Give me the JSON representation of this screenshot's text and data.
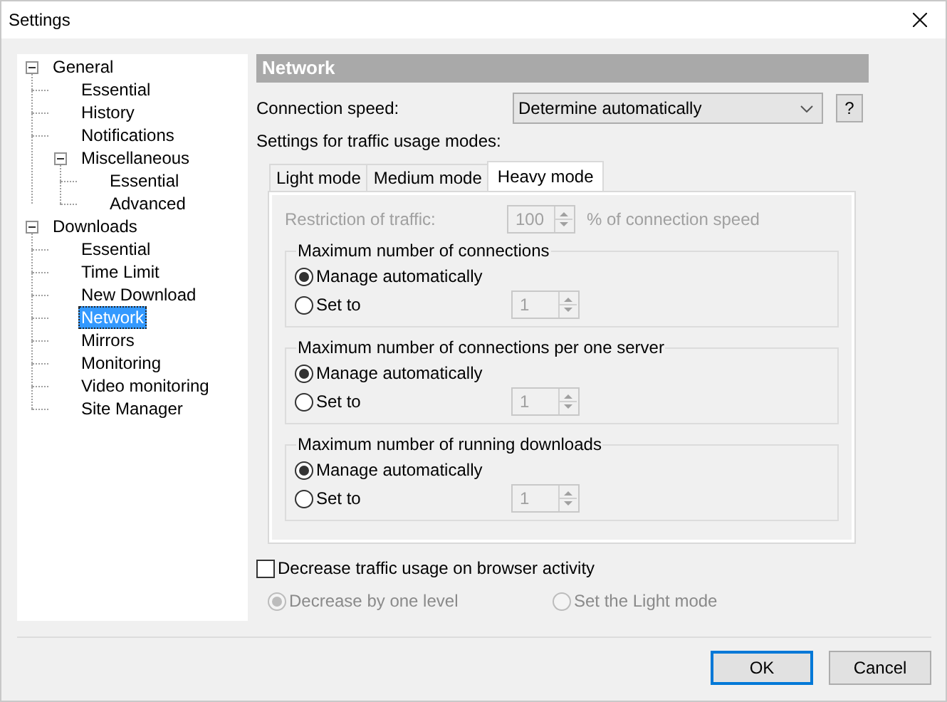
{
  "window": {
    "title": "Settings"
  },
  "tree": [
    {
      "label": "General",
      "expanded": true,
      "selected": false,
      "children": [
        {
          "label": "Essential",
          "selected": false
        },
        {
          "label": "History",
          "selected": false
        },
        {
          "label": "Notifications",
          "selected": false
        },
        {
          "label": "Miscellaneous",
          "expanded": true,
          "selected": false,
          "children": [
            {
              "label": "Essential",
              "selected": false
            },
            {
              "label": "Advanced",
              "selected": false
            }
          ]
        }
      ]
    },
    {
      "label": "Downloads",
      "expanded": true,
      "selected": false,
      "children": [
        {
          "label": "Essential",
          "selected": false
        },
        {
          "label": "Time Limit",
          "selected": false
        },
        {
          "label": "New Download",
          "selected": false
        },
        {
          "label": "Network",
          "selected": true
        },
        {
          "label": "Mirrors",
          "selected": false
        },
        {
          "label": "Monitoring",
          "selected": false
        },
        {
          "label": "Video monitoring",
          "selected": false
        },
        {
          "label": "Site Manager",
          "selected": false
        }
      ]
    }
  ],
  "section_title": "Network",
  "connection_speed": {
    "label": "Connection speed:",
    "value": "Determine automatically",
    "help_button": "?"
  },
  "modes_label": "Settings for traffic usage modes:",
  "tabs": [
    {
      "label": "Light mode",
      "selected": false
    },
    {
      "label": "Medium mode",
      "selected": false
    },
    {
      "label": "Heavy mode",
      "selected": true
    }
  ],
  "restriction": {
    "label": "Restriction of traffic:",
    "value": "100",
    "unit": "% of connection speed",
    "disabled": true
  },
  "groups": [
    {
      "title": "Maximum number of connections",
      "options": [
        {
          "label": "Manage automatically",
          "selected": true
        },
        {
          "label": "Set to",
          "selected": false
        }
      ],
      "spin_value": "1"
    },
    {
      "title": "Maximum number of connections per one server",
      "options": [
        {
          "label": "Manage automatically",
          "selected": true
        },
        {
          "label": "Set to",
          "selected": false
        }
      ],
      "spin_value": "1"
    },
    {
      "title": "Maximum number of running downloads",
      "options": [
        {
          "label": "Manage automatically",
          "selected": true
        },
        {
          "label": "Set to",
          "selected": false
        }
      ],
      "spin_value": "1"
    }
  ],
  "browser_option": {
    "label": "Decrease traffic usage on browser activity",
    "checked": false
  },
  "browser_sub_options": [
    {
      "label": "Decrease by one level",
      "selected": true,
      "disabled": true
    },
    {
      "label": "Set the Light mode",
      "selected": false,
      "disabled": true
    }
  ],
  "buttons": [
    {
      "label": "OK",
      "default": true
    },
    {
      "label": "Cancel",
      "default": false
    }
  ]
}
